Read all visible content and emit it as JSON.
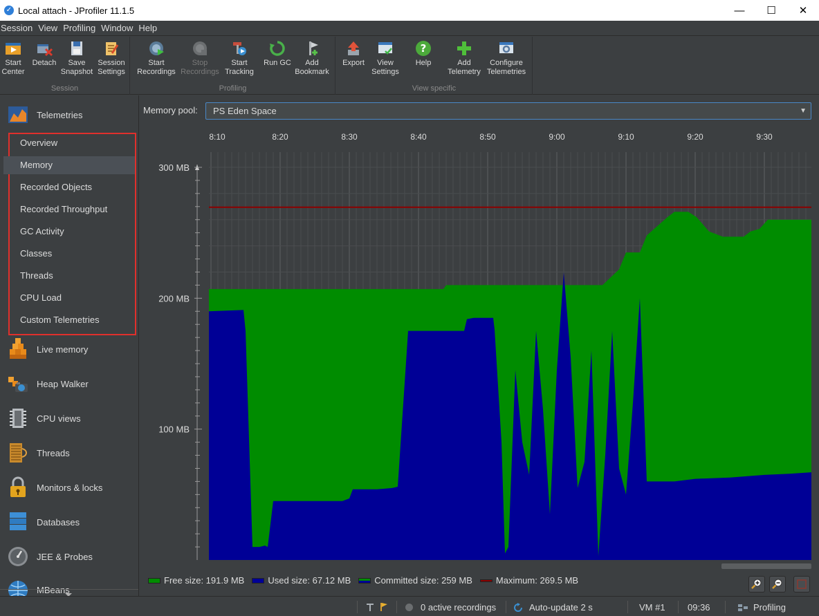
{
  "window": {
    "title": "Local attach - JProfiler 11.1.5",
    "minimize": "—",
    "maximize": "☐",
    "close": "✕"
  },
  "menu": [
    "Session",
    "View",
    "Profiling",
    "Window",
    "Help"
  ],
  "toolbar": {
    "groups": [
      {
        "label": "Session",
        "buttons": [
          {
            "label1": "Start",
            "label2": "Center",
            "icon": "start-center-icon"
          },
          {
            "label1": "Detach",
            "label2": "",
            "icon": "detach-icon"
          },
          {
            "label1": "Save",
            "label2": "Snapshot",
            "icon": "save-snapshot-icon"
          },
          {
            "label1": "Session",
            "label2": "Settings",
            "icon": "session-settings-icon"
          }
        ]
      },
      {
        "label": "Profiling",
        "buttons": [
          {
            "label1": "Start",
            "label2": "Recordings",
            "icon": "start-recordings-icon"
          },
          {
            "label1": "Stop",
            "label2": "Recordings",
            "icon": "stop-recordings-icon",
            "disabled": true
          },
          {
            "label1": "Start",
            "label2": "Tracking",
            "icon": "start-tracking-icon"
          },
          {
            "label1": "Run GC",
            "label2": "",
            "icon": "run-gc-icon"
          },
          {
            "label1": "Add",
            "label2": "Bookmark",
            "icon": "add-bookmark-icon"
          }
        ]
      },
      {
        "label": "View specific",
        "buttons": [
          {
            "label1": "Export",
            "label2": "",
            "icon": "export-icon"
          },
          {
            "label1": "View",
            "label2": "Settings",
            "icon": "view-settings-icon"
          },
          {
            "label1": "Help",
            "label2": "",
            "icon": "help-icon"
          },
          {
            "label1": "Add",
            "label2": "Telemetry",
            "icon": "add-telemetry-icon"
          },
          {
            "label1": "Configure",
            "label2": "Telemetries",
            "icon": "configure-telemetries-icon"
          }
        ]
      }
    ]
  },
  "sidebar": {
    "telemetries": "Telemetries",
    "subitems": [
      "Overview",
      "Memory",
      "Recorded Objects",
      "Recorded Throughput",
      "GC Activity",
      "Classes",
      "Threads",
      "CPU Load",
      "Custom Telemetries"
    ],
    "active_subitem": "Memory",
    "sections": [
      {
        "label": "Live memory",
        "icon": "live-memory-icon"
      },
      {
        "label": "Heap Walker",
        "icon": "heap-walker-icon"
      },
      {
        "label": "CPU views",
        "icon": "cpu-views-icon"
      },
      {
        "label": "Threads",
        "icon": "threads-icon"
      },
      {
        "label": "Monitors & locks",
        "icon": "monitors-locks-icon"
      },
      {
        "label": "Databases",
        "icon": "databases-icon"
      },
      {
        "label": "JEE & Probes",
        "icon": "jee-probes-icon"
      },
      {
        "label": "MBeans",
        "icon": "mbeans-icon"
      }
    ]
  },
  "pool": {
    "label": "Memory pool:",
    "value": "PS Eden Space"
  },
  "colors": {
    "free": "#008c00",
    "used": "#000096",
    "maximum": "#8b0000",
    "background": "#3c3f41"
  },
  "chart_data": {
    "type": "area",
    "x_unit": "time (hh:mm)",
    "time_ticks": [
      "8:10",
      "8:20",
      "8:30",
      "8:40",
      "8:50",
      "9:00",
      "9:10",
      "9:20",
      "9:30"
    ],
    "y_ticks": [
      "100 MB",
      "200 MB",
      "300 MB"
    ],
    "y_unit": "MB",
    "ylim": [
      0,
      300
    ],
    "xlim_minutes": [
      489.7,
      576.8
    ],
    "maximum_mb": 269.5,
    "series": [
      {
        "name": "Committed size",
        "points": [
          [
            489.7,
            207
          ],
          [
            496,
            207
          ],
          [
            501,
            207
          ],
          [
            506,
            207
          ],
          [
            513,
            207
          ],
          [
            518,
            207
          ],
          [
            523.6,
            207
          ],
          [
            524,
            210
          ],
          [
            536,
            210
          ],
          [
            541,
            210
          ],
          [
            546.6,
            210
          ],
          [
            547.6,
            215
          ],
          [
            549,
            222
          ],
          [
            550,
            235
          ],
          [
            552,
            235
          ],
          [
            553,
            248
          ],
          [
            556,
            262
          ],
          [
            557,
            266
          ],
          [
            559,
            266
          ],
          [
            560.2,
            262
          ],
          [
            562,
            251
          ],
          [
            564,
            247
          ],
          [
            567,
            247
          ],
          [
            568,
            251
          ],
          [
            569.3,
            253
          ],
          [
            570.5,
            260
          ],
          [
            576.8,
            260
          ]
        ]
      },
      {
        "name": "Used size",
        "points": [
          [
            489.7,
            190
          ],
          [
            494.7,
            191
          ],
          [
            495,
            175
          ],
          [
            496,
            10
          ],
          [
            497,
            10
          ],
          [
            497.8,
            11
          ],
          [
            498.2,
            10
          ],
          [
            499,
            45
          ],
          [
            508,
            45
          ],
          [
            509,
            45
          ],
          [
            510,
            47
          ],
          [
            510.5,
            54
          ],
          [
            514,
            54
          ],
          [
            516.2,
            55
          ],
          [
            517,
            56
          ],
          [
            518.5,
            175
          ],
          [
            524,
            175
          ],
          [
            526.6,
            175
          ],
          [
            527,
            184
          ],
          [
            528,
            185
          ],
          [
            529.5,
            185
          ],
          [
            530.8,
            185
          ],
          [
            531,
            176
          ],
          [
            532,
            90
          ],
          [
            532.5,
            5
          ],
          [
            533,
            10
          ],
          [
            534,
            145
          ],
          [
            535,
            90
          ],
          [
            536,
            65
          ],
          [
            537,
            175
          ],
          [
            538,
            115
          ],
          [
            539,
            35
          ],
          [
            540,
            145
          ],
          [
            541,
            220
          ],
          [
            542,
            155
          ],
          [
            543,
            55
          ],
          [
            544,
            75
          ],
          [
            545,
            160
          ],
          [
            546,
            3
          ],
          [
            547,
            80
          ],
          [
            548,
            175
          ],
          [
            549,
            70
          ],
          [
            550,
            50
          ],
          [
            551,
            120
          ],
          [
            552,
            200
          ],
          [
            553,
            60
          ],
          [
            554,
            60
          ],
          [
            557,
            60
          ],
          [
            560,
            62
          ],
          [
            565,
            63
          ],
          [
            570,
            65
          ],
          [
            574,
            66
          ],
          [
            576.8,
            67
          ]
        ]
      }
    ]
  },
  "legend": [
    {
      "label": "Free size: 191.9 MB",
      "key": "free"
    },
    {
      "label": "Used size: 67.12 MB",
      "key": "used"
    },
    {
      "label": "Committed size: 259 MB",
      "key": "committed"
    },
    {
      "label": "Maximum: 269.5 MB",
      "key": "maximum"
    }
  ],
  "status": {
    "recordings": "0 active recordings",
    "autoupdate": "Auto-update 2 s",
    "vm": "VM #1",
    "time": "09:36",
    "mode": "Profiling"
  }
}
